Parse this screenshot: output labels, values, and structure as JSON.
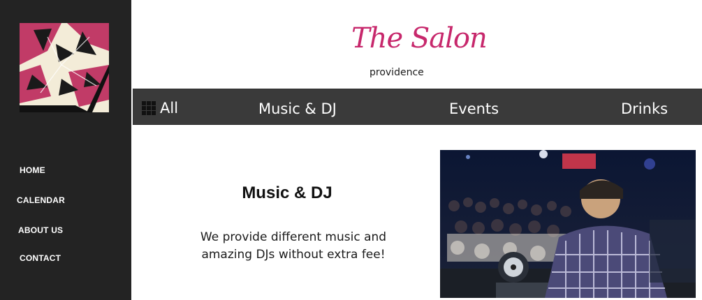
{
  "sidebar": {
    "nav": [
      {
        "label": "HOME"
      },
      {
        "label": "CALENDAR"
      },
      {
        "label": "ABOUT US"
      },
      {
        "label": "CONTACT"
      }
    ]
  },
  "brand": {
    "title": "The Salon",
    "subtitle": "providence",
    "accent_color": "#c7286c"
  },
  "topnav": {
    "tabs": [
      {
        "label": "All",
        "icon": "grid-icon"
      },
      {
        "label": "Music & DJ"
      },
      {
        "label": "Events"
      },
      {
        "label": "Drinks"
      }
    ]
  },
  "content": {
    "heading": "Music & DJ",
    "description": "We provide different music and amazing DJs without extra fee!"
  }
}
